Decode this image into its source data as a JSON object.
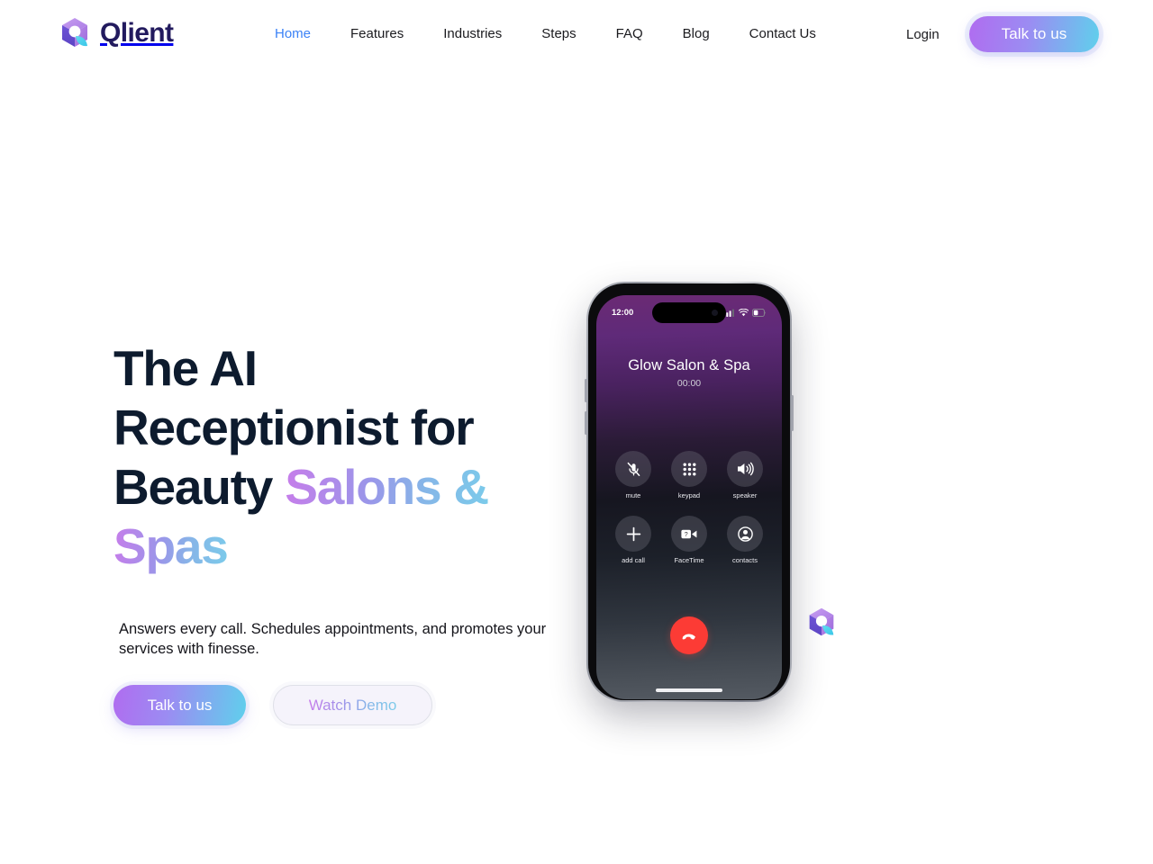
{
  "brand": {
    "name": "Qlient",
    "logo_icon": "qlient-cube-logo"
  },
  "nav": {
    "links": [
      {
        "label": "Home",
        "active": true
      },
      {
        "label": "Features",
        "active": false
      },
      {
        "label": "Industries",
        "active": false
      },
      {
        "label": "Steps",
        "active": false
      },
      {
        "label": "FAQ",
        "active": false
      },
      {
        "label": "Blog",
        "active": false
      },
      {
        "label": "Contact Us",
        "active": false
      }
    ],
    "login_label": "Login",
    "cta_label": "Talk to us"
  },
  "hero": {
    "heading_line1": "The AI",
    "heading_line2": "Receptionist for",
    "heading_line3_dark": "Beauty ",
    "heading_line3_gradient": "Salons &",
    "heading_line4_gradient": "Spas",
    "subtitle": "Answers every call. Schedules appointments, and promotes your services with finesse.",
    "primary_button": "Talk to us",
    "secondary_button": "Watch Demo"
  },
  "phone": {
    "status_time": "12:00",
    "signal_icon": "cellular-signal-icon",
    "wifi_icon": "wifi-icon",
    "battery_icon": "battery-icon",
    "caller_name": "Glow Salon & Spa",
    "call_timer": "00:00",
    "controls": [
      {
        "label": "mute",
        "icon": "microphone-muted-icon"
      },
      {
        "label": "keypad",
        "icon": "keypad-icon"
      },
      {
        "label": "speaker",
        "icon": "speaker-icon"
      },
      {
        "label": "add call",
        "icon": "plus-icon"
      },
      {
        "label": "FaceTime",
        "icon": "video-camera-icon"
      },
      {
        "label": "contacts",
        "icon": "person-circle-icon"
      }
    ],
    "end_call_icon": "end-call-icon",
    "home_indicator": "home-indicator"
  },
  "floating_badge": {
    "icon": "qlient-cube-logo"
  },
  "colors": {
    "accent_blue": "#3b82f6",
    "heading_dark": "#0d1b2e",
    "gradient_start": "#b06cf0",
    "gradient_mid": "#9b8cf2",
    "gradient_end": "#5fd0ec",
    "end_call_red": "#fc3b35",
    "brand_navy": "#221a5e"
  }
}
